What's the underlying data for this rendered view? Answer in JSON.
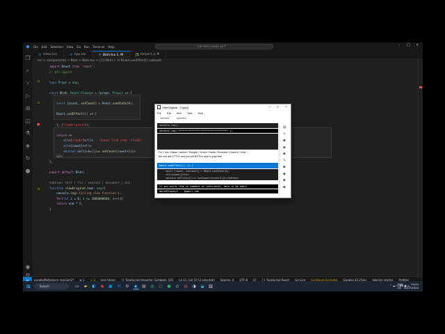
{
  "vscode": {
    "menu": [
      "File",
      "Edit",
      "Selection",
      "View",
      "Go",
      "Run",
      "Terminal",
      "Help"
    ],
    "command_center": "rcb-learn-nextjs-perf",
    "tabs": [
      {
        "label": "index.tsx",
        "icon": "react-icon",
        "active": false
      },
      {
        "label": "App.tsx",
        "icon": "react-icon",
        "active": false
      },
      {
        "label": "Blah.tsx 1, M",
        "icon": "react-icon",
        "active": true
      },
      {
        "label": "helper1.js M",
        "icon": "js-icon",
        "active": false
      }
    ],
    "breadcrumb": "src > components > Blah > Blah.tsx > [∅] Blah > ⊙ React.useEffect() callback",
    "code_lines": [
      {
        "html": "<span class='kp'>import</span> <span class='vr'>React</span> <span class='kp'>from</span> <span class='st'>'react'</span>;"
      },
      {
        "html": "<span class='cm'>// @ts-ignore</span>"
      },
      {
        "html": ""
      },
      {
        "html": "<span class='kw'>type</span> <span class='ty'>Props</span> = <span class='ty'>any</span>;"
      },
      {
        "html": ""
      },
      {
        "html": "<span class='kw'>const</span> <span class='fn'>Blah</span>: <span class='ty'>React.FC</span>&lt;<span class='ty'>any</span>&gt; = (<span class='vr'>props</span>: <span class='ty'>Props</span>) =&gt; {"
      },
      {
        "html": ""
      },
      {
        "html": "    <span class='kw'>const</span> [<span class='vr'>count</span>, <span class='fn'>setCount</span>] = <span class='vr'>React</span>.<span class='fn'>useState</span>(<span class='nm'>0</span>);"
      },
      {
        "html": ""
      },
      {
        "html": "    <span class='vr'>React</span>.<span class='fn'>useEffect</span>(() =&gt; {"
      },
      {
        "html": ""
      },
      {
        "html": "    }, [<span class='er'>slowOriginal</span>]);"
      },
      {
        "html": ""
      },
      {
        "html": "    <span class='kp'>return</span> &lt;&gt;"
      },
      {
        "html": "        &lt;<span class='kw'>h1</span>&gt;{<span class='er'>slowOr</span>}&lt;/<span class='kw'>h1</span>&gt; <span class='errtxt'>Cannot find name 'slowOr</span>"
      },
      {
        "html": "        &lt;<span class='kw'>h1</span>&gt;{<span class='vr'>count</span>}&lt;/<span class='kw'>h1</span>&gt;"
      },
      {
        "html": "        &lt;<span class='kw'>button</span> <span class='vr'>onClick</span>={()=&gt; <span class='fn'>setCount</span>(<span class='vr'>count</span>+<span class='nm'>1</span>)}&gt;"
      },
      {
        "html": "    &lt;/&gt;;"
      },
      {
        "html": "};"
      },
      {
        "html": ""
      },
      {
        "html": "<span class='kp'>export default</span> <span class='vr'>Blah</span>;"
      },
      {
        "html": ""
      },
      {
        "html": "<span style='color:#8a8a8a'>tabnine: test | fix | explain | document | ask</span>"
      },
      {
        "html": "<span class='kw'>function</span> <span class='fn'>slowOriginal</span>(<span class='vr'>num</span>: <span class='ty'>any</span>){"
      },
      {
        "html": "    <span class='vr'>console</span>.<span class='fn'>log</span>(<span class='st'>'Calling slow function'</span>);"
      },
      {
        "html": "    <span class='kp'>for</span>(<span class='kw'>let</span> <span class='vr'>i</span> = <span class='nm'>0</span>; <span class='vr'>i</span> &lt;= <span class='nm'>1000000000</span>; <span class='vr'>i</span>++){}"
      },
      {
        "html": "    <span class='kp'>return</span> <span class='vr'>num</span> * <span class='nm'>2</span>;"
      },
      {
        "html": "}"
      }
    ],
    "status": {
      "branch": "parallelReference_revision2*",
      "errors": "⊗ 1",
      "warnings": "⚠ 3",
      "items": [
        "Live Share",
        "{} TypeScript Importer: Symbols: 101",
        "Ln 11, Col 15 (2 selected)",
        "Spaces: 4",
        "UTF-8",
        "LF",
        "{} TypeScript React",
        "Go Live",
        "Configure Excludes",
        "Quokka 42.25ms",
        "tabnine starter",
        "Prettier"
      ]
    }
  },
  "taskbar": {
    "search": "Search",
    "tray_lang": "ENG\nUS",
    "time": "20:22",
    "date": "12/07/2024"
  },
  "clipboard": {
    "title": "UserOriginal - CopyQ",
    "menu": [
      "File",
      "Edit",
      "Item",
      "Tabs",
      "Help"
    ],
    "tabs": [
      "favorites",
      "clipboard"
    ],
    "items": [
      {
        "text": "console.log()",
        "style": "dark"
      },
      {
        "text": "console.log('**********************************');",
        "style": "blackbar"
      },
      {
        "text": "",
        "style": "dark"
      },
      {
        "text": "For 2 sec: Dallas / Autism / Rengarf / Kensh / Kalita / Ronaldar / Dravers / Gear ...",
        "style": "txt"
      },
      {
        "text": "the rest are LITTLE and you will NOT be able to play this!",
        "style": "txt"
      },
      {
        "text": "React.useEffect(() => {",
        "style": "sel"
      },
      {
        "text": "const [count, setCount] = React.useState(0);",
        "style": "dark"
      },
      {
        "text": "<h1>{count}</h1>",
        "style": "dark"
      },
      {
        "text": "<button onClick={()=> setCount(count+1)}></button>",
        "style": "dark"
      },
      {
        "text": "If you would like to comment or contribute, here is my email",
        "style": "blackbar"
      },
      {
        "text": "david@reposit... @gmail.com",
        "style": "blackbar"
      }
    ]
  }
}
